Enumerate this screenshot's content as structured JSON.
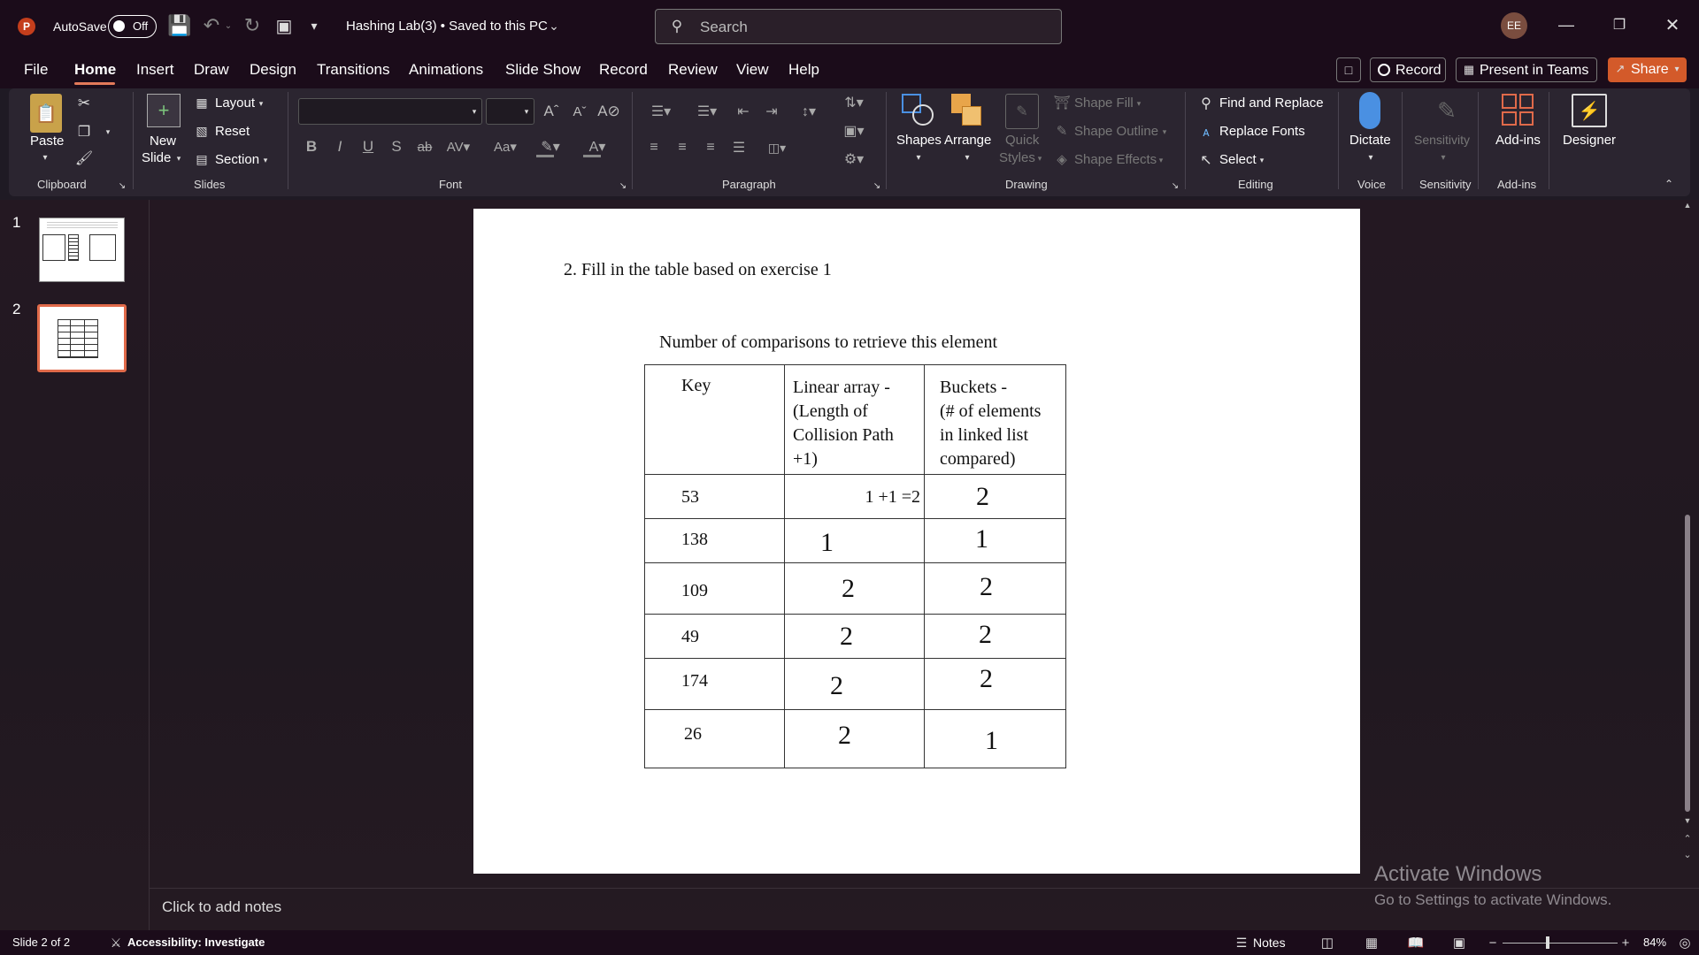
{
  "titlebar": {
    "autosave_label": "AutoSave",
    "autosave_state": "Off",
    "doc_title": "Hashing Lab(3) • Saved to this PC",
    "search_placeholder": "Search",
    "user_initials": "EE"
  },
  "tabs": [
    "File",
    "Home",
    "Insert",
    "Draw",
    "Design",
    "Transitions",
    "Animations",
    "Slide Show",
    "Record",
    "Review",
    "View",
    "Help"
  ],
  "active_tab": "Home",
  "tab_buttons": {
    "record": "Record",
    "present": "Present in Teams",
    "share": "Share"
  },
  "ribbon": {
    "clipboard": {
      "paste": "Paste",
      "group": "Clipboard"
    },
    "slides": {
      "new_slide_1": "New",
      "new_slide_2": "Slide",
      "layout": "Layout",
      "reset": "Reset",
      "section": "Section",
      "group": "Slides"
    },
    "font": {
      "group": "Font"
    },
    "paragraph": {
      "group": "Paragraph"
    },
    "drawing": {
      "shapes": "Shapes",
      "arrange": "Arrange",
      "quick_styles_1": "Quick",
      "quick_styles_2": "Styles",
      "shape_fill": "Shape Fill",
      "shape_outline": "Shape Outline",
      "shape_effects": "Shape Effects",
      "group": "Drawing"
    },
    "editing": {
      "find_replace": "Find and Replace",
      "replace_fonts": "Replace Fonts",
      "select": "Select",
      "group": "Editing"
    },
    "voice": {
      "dictate": "Dictate",
      "group": "Voice"
    },
    "sensitivity": {
      "label": "Sensitivity",
      "group": "Sensitivity"
    },
    "addins": {
      "label": "Add-ins",
      "group": "Add-ins"
    },
    "designer": {
      "label": "Designer"
    }
  },
  "thumbnails": [
    {
      "num": "1"
    },
    {
      "num": "2"
    }
  ],
  "slide": {
    "instruction": "2.  Fill in the table based on exercise 1",
    "table_caption": "Number of comparisons to retrieve this element",
    "headers": {
      "key": "Key",
      "linear": [
        "Linear array -",
        "(Length of",
        "Collision Path",
        "+1)"
      ],
      "buckets": [
        "Buckets -",
        "(# of elements",
        "in  linked list",
        "compared)"
      ]
    },
    "rows": [
      {
        "key": "53",
        "linear": "1 +1 =2",
        "buckets": "2"
      },
      {
        "key": "138",
        "linear": "1",
        "buckets": "1"
      },
      {
        "key": "109",
        "linear": "2",
        "buckets": "2"
      },
      {
        "key": "49",
        "linear": "2",
        "buckets": "2"
      },
      {
        "key": "174",
        "linear": "2",
        "buckets": "2"
      },
      {
        "key": "26",
        "linear": "2",
        "buckets": "1"
      }
    ]
  },
  "notes_placeholder": "Click to add notes",
  "watermark": {
    "line1": "Activate Windows",
    "line2": "Go to Settings to activate Windows."
  },
  "status": {
    "slide_info": "Slide 2 of 2",
    "accessibility": "Accessibility: Investigate",
    "notes": "Notes",
    "zoom": "84%"
  }
}
